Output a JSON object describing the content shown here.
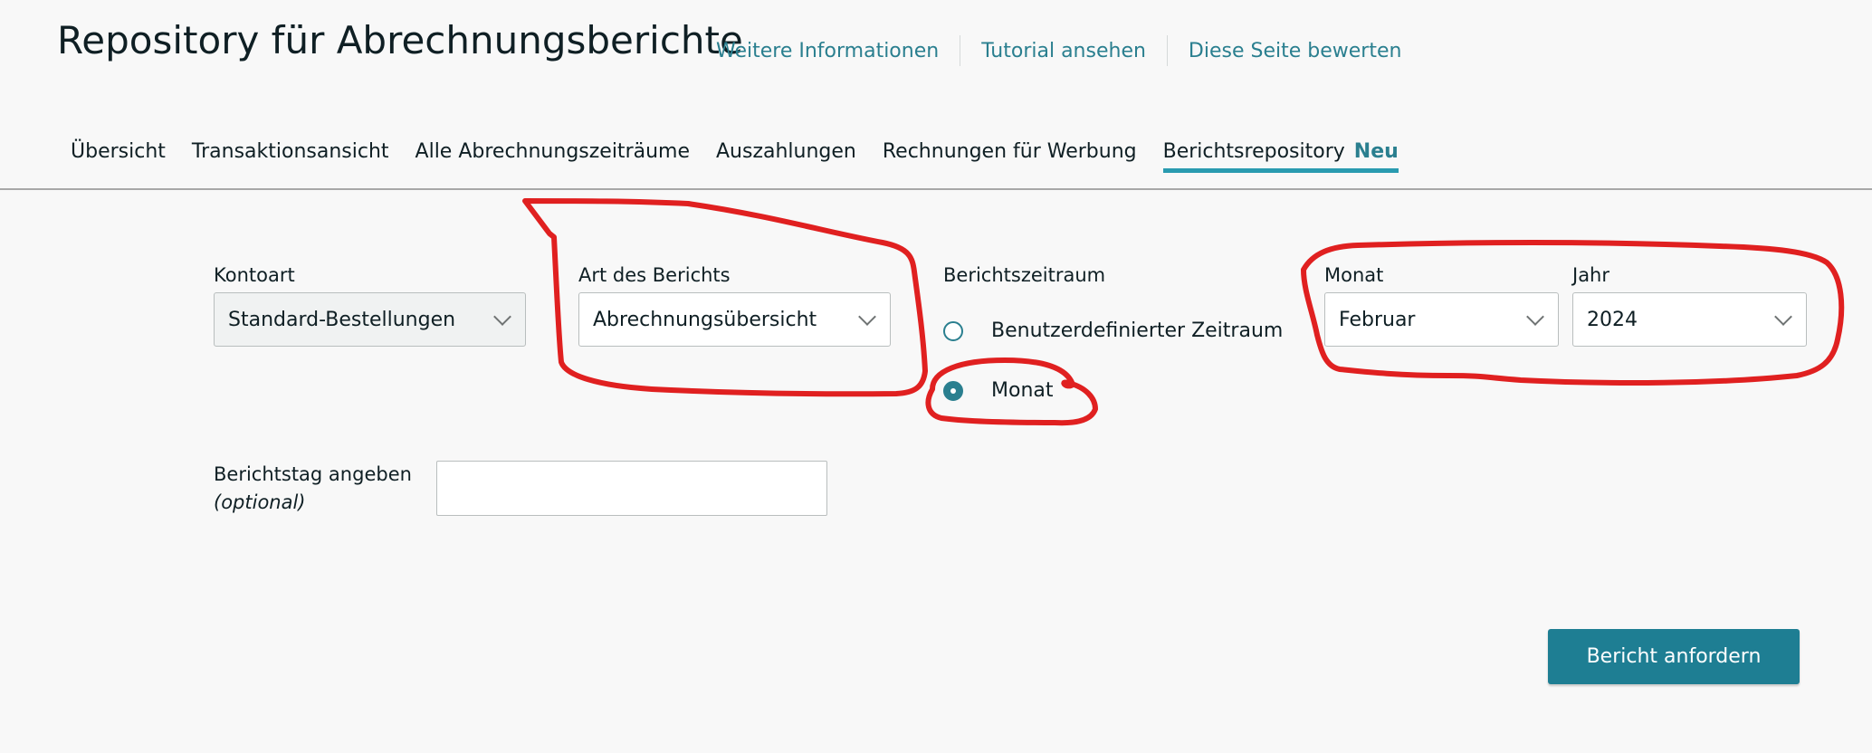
{
  "header": {
    "title": "Repository für Abrechnungsberichte",
    "links": [
      "Weitere Informationen",
      "Tutorial ansehen",
      "Diese Seite bewerten"
    ]
  },
  "tabs": [
    {
      "label": "Übersicht"
    },
    {
      "label": "Transaktionsansicht"
    },
    {
      "label": "Alle Abrechnungszeiträume"
    },
    {
      "label": "Auszahlungen"
    },
    {
      "label": "Rechnungen für Werbung"
    },
    {
      "label": "Berichtsrepository",
      "badge": "Neu",
      "active": true
    }
  ],
  "form": {
    "account_type": {
      "label": "Kontoart",
      "value": "Standard-Bestellungen"
    },
    "report_type": {
      "label": "Art des Berichts",
      "value": "Abrechnungsübersicht"
    },
    "report_period": {
      "label": "Berichtszeitraum",
      "options": [
        "Benutzerdefinierter Zeitraum",
        "Monat"
      ],
      "selected": "Monat"
    },
    "month": {
      "label": "Monat",
      "value": "Februar"
    },
    "year": {
      "label": "Jahr",
      "value": "2024"
    },
    "report_day": {
      "label": "Berichtstag angeben",
      "optional": "(optional)",
      "value": ""
    },
    "submit_label": "Bericht anfordern"
  },
  "colors": {
    "accent": "#1e7e93",
    "link": "#2a7f8f",
    "annotation": "#e02020"
  }
}
